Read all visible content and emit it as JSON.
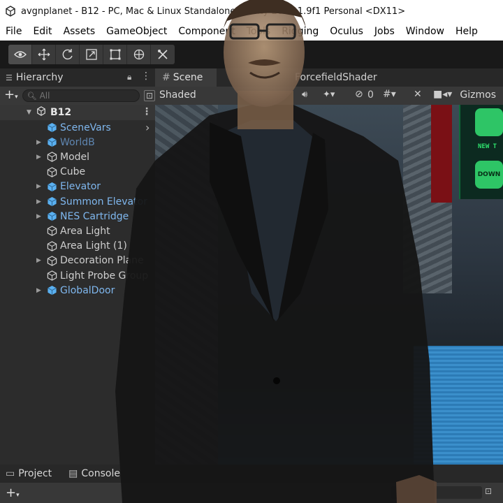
{
  "window": {
    "title": "avgnplanet - B12 - PC, Mac & Linux Standalone - Unity 2021.1.9f1 Personal <DX11>"
  },
  "menu": {
    "items": [
      "File",
      "Edit",
      "Assets",
      "GameObject",
      "Component",
      "Tools",
      "Rigging",
      "Oculus",
      "Jobs",
      "Window",
      "Help"
    ]
  },
  "toolbar": {
    "tools": [
      "eye-icon",
      "move-icon",
      "rotate-icon",
      "scale-icon",
      "rect-icon",
      "transform-icon",
      "custom-tool-icon"
    ]
  },
  "hierarchy": {
    "tab_label": "Hierarchy",
    "search_placeholder": "All",
    "scene_name": "B12",
    "items": [
      {
        "label": "SceneVars",
        "type": "prefab",
        "expandable": false
      },
      {
        "label": "WorldB",
        "type": "prefab-dim",
        "expandable": true
      },
      {
        "label": "Model",
        "type": "object",
        "expandable": true
      },
      {
        "label": "Cube",
        "type": "object",
        "expandable": false
      },
      {
        "label": "Elevator",
        "type": "prefab",
        "expandable": true
      },
      {
        "label": "Summon Elevator",
        "type": "prefab",
        "expandable": true
      },
      {
        "label": "NES Cartridge",
        "type": "prefab",
        "expandable": true
      },
      {
        "label": "Area Light",
        "type": "object",
        "expandable": false
      },
      {
        "label": "Area Light (1)",
        "type": "object",
        "expandable": false
      },
      {
        "label": "Decoration Plane",
        "type": "object",
        "expandable": true
      },
      {
        "label": "Light Probe Group",
        "type": "object",
        "expandable": false
      },
      {
        "label": "GlobalDoor",
        "type": "prefab",
        "expandable": true
      }
    ]
  },
  "scene": {
    "tab_label": "Scene",
    "second_tab_label": "ForcefieldShader",
    "shading_mode": "Shaded",
    "hidden_count": "0",
    "gizmos_label": "Gizmos",
    "screen_text": "NEW T",
    "screen_button": "DOWN"
  },
  "bottom": {
    "project_tab": "Project",
    "console_tab": "Console"
  },
  "colors": {
    "prefab_text": "#7fb7ee",
    "panel_bg": "#2c2c2c",
    "toolbar_bg": "#191919"
  }
}
